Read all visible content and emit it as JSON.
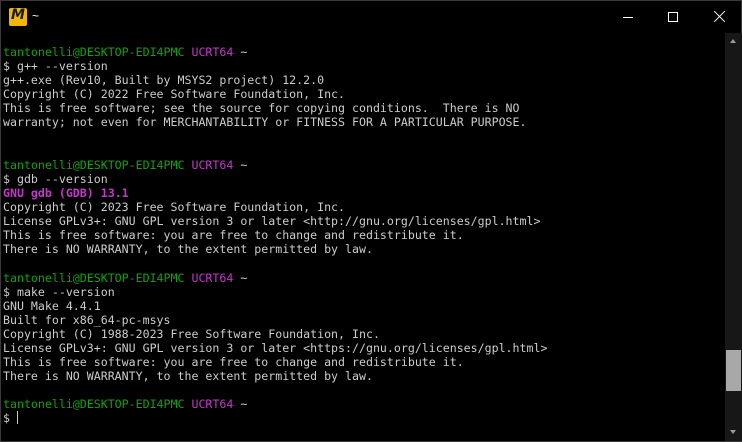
{
  "window": {
    "app_icon_letter": "M",
    "title": "~"
  },
  "terminal": {
    "blocks": [
      {
        "prompt": {
          "user": "tantonelli@DESKTOP-EDI4PMC",
          "env": "UCRT64",
          "path": "~"
        },
        "command": "$ g++ --version",
        "output": [
          "g++.exe (Rev10, Built by MSYS2 project) 12.2.0",
          "Copyright (C) 2022 Free Software Foundation, Inc.",
          "This is free software; see the source for copying conditions.  There is NO",
          "warranty; not even for MERCHANTABILITY or FITNESS FOR A PARTICULAR PURPOSE.",
          "",
          ""
        ]
      },
      {
        "prompt": {
          "user": "tantonelli@DESKTOP-EDI4PMC",
          "env": "UCRT64",
          "path": "~"
        },
        "command": "$ gdb --version",
        "gdb_banner": "GNU gdb (GDB) 13.1",
        "output": [
          "Copyright (C) 2023 Free Software Foundation, Inc.",
          "License GPLv3+: GNU GPL version 3 or later <http://gnu.org/licenses/gpl.html>",
          "This is free software: you are free to change and redistribute it.",
          "There is NO WARRANTY, to the extent permitted by law.",
          ""
        ]
      },
      {
        "prompt": {
          "user": "tantonelli@DESKTOP-EDI4PMC",
          "env": "UCRT64",
          "path": "~"
        },
        "command": "$ make --version",
        "output": [
          "GNU Make 4.4.1",
          "Built for x86_64-pc-msys",
          "Copyright (C) 1988-2023 Free Software Foundation, Inc.",
          "License GPLv3+: GNU GPL version 3 or later <https://gnu.org/licenses/gpl.html>",
          "This is free software: you are free to change and redistribute it.",
          "There is NO WARRANTY, to the extent permitted by law.",
          ""
        ]
      }
    ],
    "final_prompt": {
      "user": "tantonelli@DESKTOP-EDI4PMC",
      "env": "UCRT64",
      "path": "~"
    },
    "input_prompt": "$ ",
    "input_value": ""
  },
  "scrollbar": {
    "position": 0.9
  },
  "colors": {
    "background": "#000000",
    "text": "#cccccc",
    "user": "#13a10e",
    "env": "#c239c8",
    "app_icon": "#f2b705"
  },
  "icons": {
    "app": "mintty-icon",
    "minimize": "minimize-icon",
    "maximize": "maximize-icon",
    "close": "close-icon"
  }
}
